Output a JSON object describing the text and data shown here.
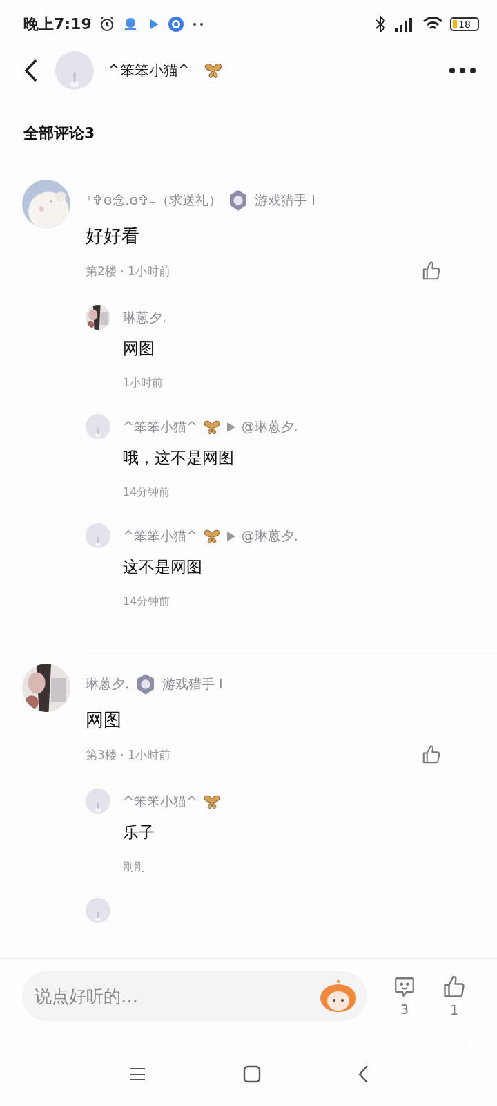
{
  "status_bar": {
    "time": "晚上7:19",
    "battery": "18"
  },
  "header": {
    "title": "^笨笨小猫^",
    "butterfly": true
  },
  "section_title": "全部评论3",
  "comments": [
    {
      "author": "⁺✞ɞ念.ɞ✞₊（求送礼）",
      "butterfly": false,
      "badge": "游戏猎手 Ⅰ",
      "text": "好好看",
      "meta": "第2楼 · 1小时前",
      "replies": [
        {
          "author": "琳蒽夕.",
          "butterfly": false,
          "text": "网图",
          "time": "1小时前"
        },
        {
          "author": "^笨笨小猫^",
          "butterfly": true,
          "reply_to": "@琳蒽夕.",
          "text": "哦，这不是网图",
          "time": "14分钟前"
        },
        {
          "author": "^笨笨小猫^",
          "butterfly": true,
          "reply_to": "@琳蒽夕.",
          "text": "这不是网图",
          "time": "14分钟前"
        }
      ]
    },
    {
      "author": "琳蒽夕.",
      "butterfly": false,
      "badge": "游戏猎手 Ⅰ",
      "text": "网图",
      "meta": "第3楼 · 1小时前",
      "more_replies_below": true,
      "replies": [
        {
          "author": "^笨笨小猫^",
          "butterfly": true,
          "text": "乐子",
          "time": "刚刚"
        }
      ]
    }
  ],
  "composer": {
    "placeholder": "说点好听的…",
    "comment_count": "3",
    "like_count": "1"
  }
}
